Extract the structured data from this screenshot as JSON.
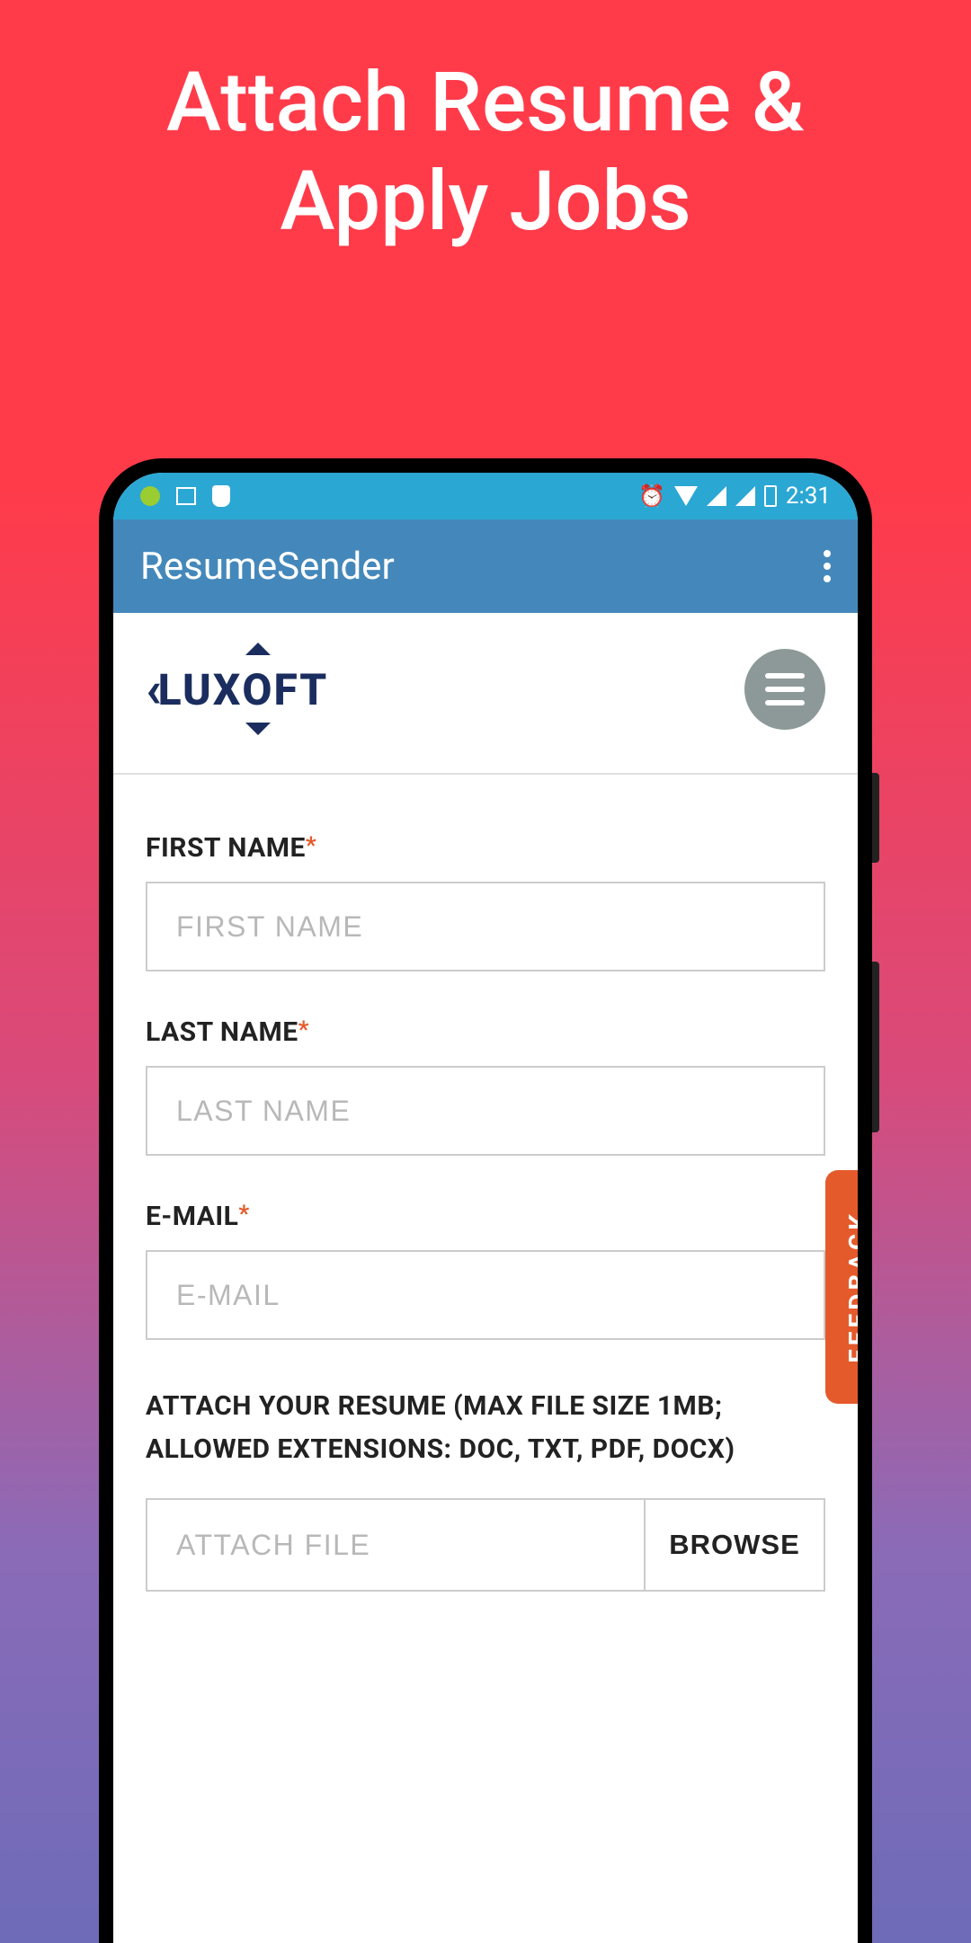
{
  "promo": {
    "title_line1": "Attach Resume &",
    "title_line2": "Apply Jobs"
  },
  "status_bar": {
    "time": "2:31"
  },
  "app_bar": {
    "title": "ResumeSender"
  },
  "logo": {
    "brand_prefix": "LUX",
    "brand_o": "O",
    "brand_suffix": "FT"
  },
  "form": {
    "first_name": {
      "label": "FIRST NAME",
      "placeholder": "FIRST NAME"
    },
    "last_name": {
      "label": "LAST NAME",
      "placeholder": "LAST NAME"
    },
    "email": {
      "label": "E-MAIL",
      "placeholder": "E-MAIL"
    },
    "attach": {
      "label": "ATTACH YOUR RESUME (MAX FILE SIZE 1MB; ALLOWED EXTENSIONS: DOC, TXT, PDF, DOCX)",
      "placeholder": "ATTACH FILE",
      "browse_label": "BROWSE"
    },
    "required_mark": "*"
  },
  "feedback": {
    "label": "FEEDBACK"
  }
}
